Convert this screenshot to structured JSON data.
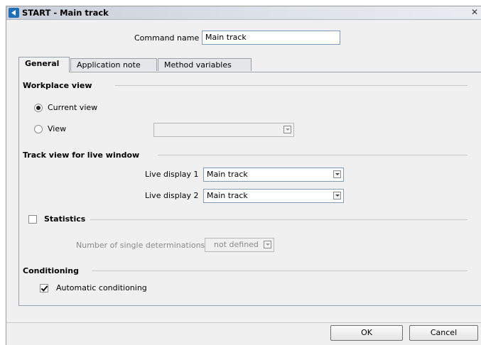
{
  "window": {
    "title": "START - Main track"
  },
  "command": {
    "label": "Command name",
    "value": "Main track"
  },
  "tabs": [
    {
      "label": "General",
      "active": true
    },
    {
      "label": "Application note",
      "active": false
    },
    {
      "label": "Method variables",
      "active": false
    }
  ],
  "workplace": {
    "title": "Workplace view",
    "options": [
      {
        "label": "Current view",
        "checked": true
      },
      {
        "label": "View",
        "checked": false
      }
    ],
    "view_select_value": ""
  },
  "track_view": {
    "title": "Track view for live window",
    "rows": [
      {
        "label": "Live display 1",
        "value": "Main track"
      },
      {
        "label": "Live display 2",
        "value": "Main track"
      }
    ]
  },
  "statistics": {
    "title": "Statistics",
    "checked": false,
    "determinations_label": "Number of single determinations",
    "determinations_value": "not defined"
  },
  "conditioning": {
    "title": "Conditioning",
    "auto_label": "Automatic conditioning",
    "auto_checked": true
  },
  "buttons": {
    "ok": "OK",
    "cancel": "Cancel"
  },
  "icons": {
    "app": "app-logo-icon",
    "close": "close-icon",
    "dropdown": "chevron-down-icon"
  }
}
